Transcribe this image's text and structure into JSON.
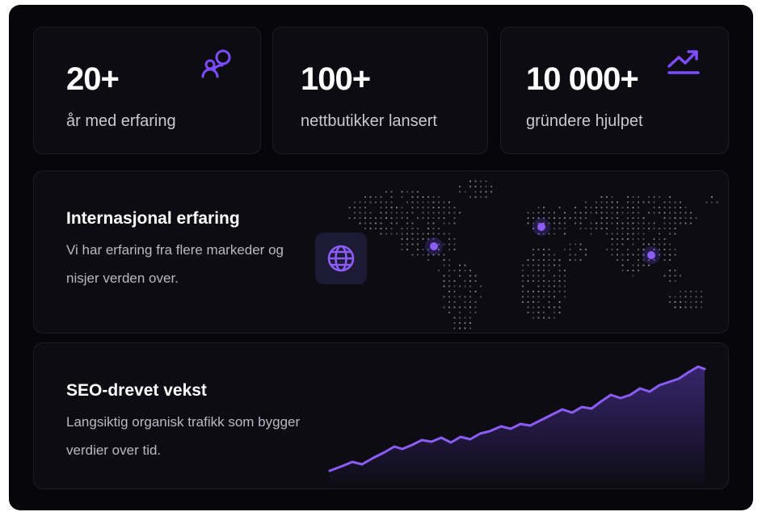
{
  "stats": [
    {
      "value": "20+",
      "label": "år med erfaring",
      "icon": "users-icon"
    },
    {
      "value": "100+",
      "label": "nettbutikker lansert",
      "icon": ""
    },
    {
      "value": "10 000+",
      "label": "gründere hjulpet",
      "icon": "trending-up-icon"
    }
  ],
  "international": {
    "title": "Internasjonal erfaring",
    "description": "Vi har erfaring fra flere markeder og nisjer verden over.",
    "icon": "globe-icon"
  },
  "seo": {
    "title": "SEO-drevet vekst",
    "description": "Langsiktig organisk trafikk som bygger verdier over tid."
  },
  "colors": {
    "background": "#07070b",
    "card": "#0c0c12",
    "accent": "#7c4dff"
  }
}
